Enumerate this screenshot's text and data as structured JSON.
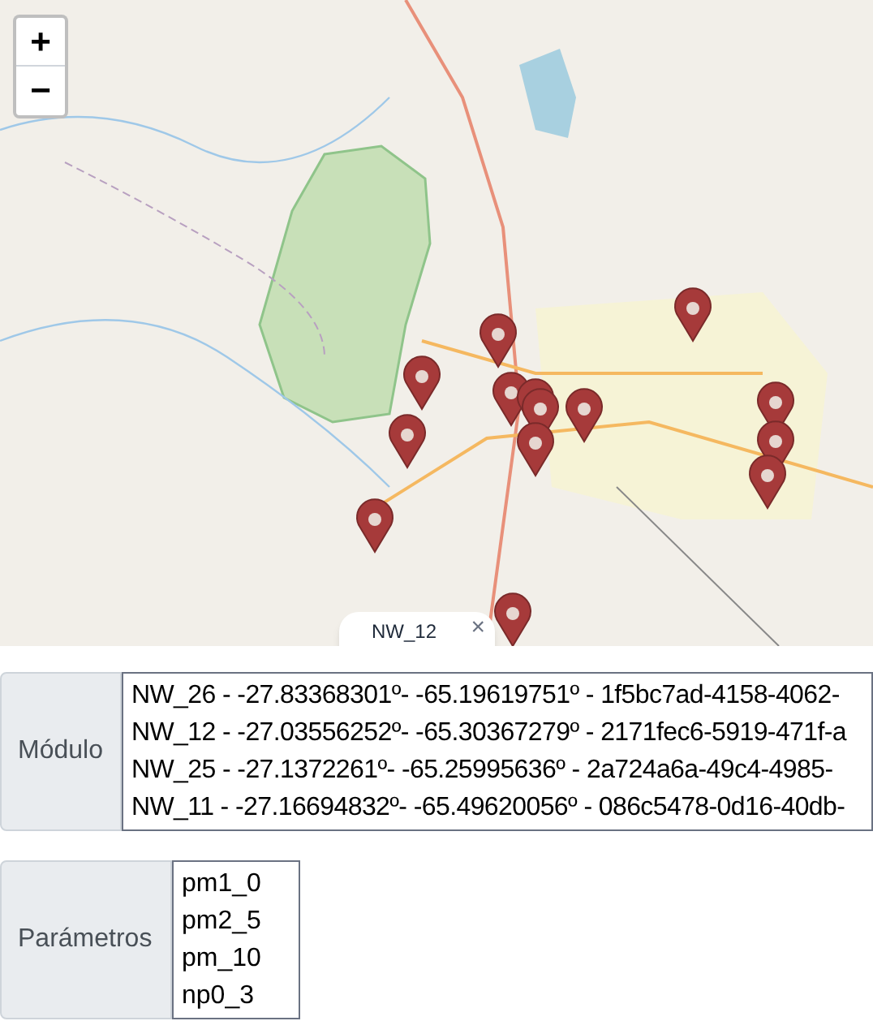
{
  "map": {
    "zoom_in": "+",
    "zoom_out": "−",
    "popup": {
      "text": "NW_12",
      "close": "×"
    }
  },
  "fields": [
    {
      "label": "Módulo",
      "options": [
        "NW_26 - -27.83368301º- -65.19619751º - 1f5bc7ad-4158-4062-",
        "NW_12 - -27.03556252º- -65.30367279º - 2171fec6-5919-471f-a",
        "NW_25 - -27.1372261º- -65.25995636º - 2a724a6a-49c4-4985-",
        "NW_11 - -27.16694832º- -65.49620056º - 086c5478-0d16-40db-"
      ]
    },
    {
      "label": "Parámetros",
      "options": [
        "pm1_0",
        "pm2_5",
        "pm_10",
        "np0_3"
      ]
    }
  ]
}
